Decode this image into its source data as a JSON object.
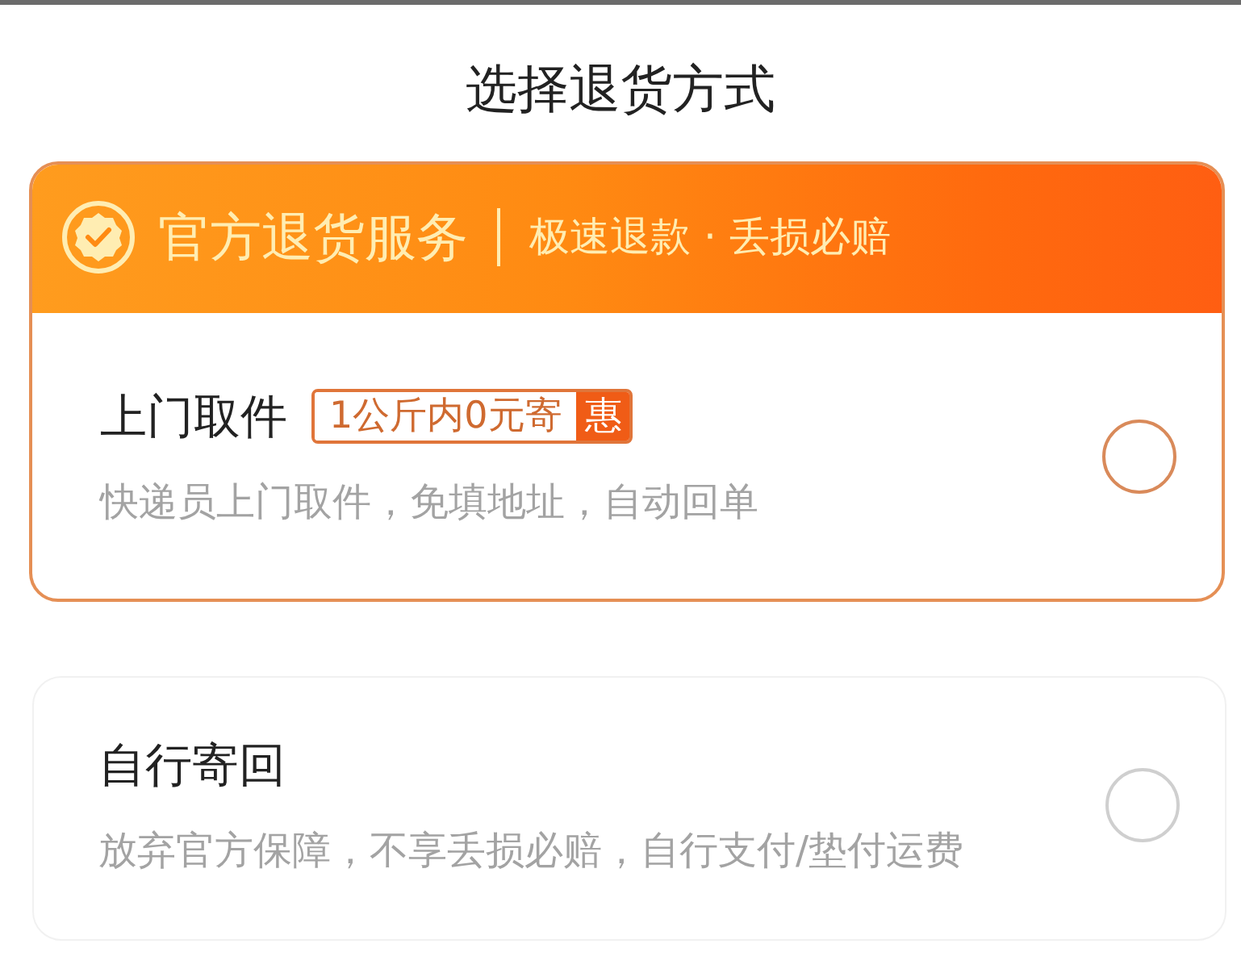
{
  "title": "选择退货方式",
  "options": [
    {
      "kind": "official",
      "banner": {
        "title": "官方退货服务",
        "tagline": "极速退款 · 丢损必赔"
      },
      "name": "上门取件",
      "tag": {
        "text": "1公斤内0元寄",
        "mark": "惠"
      },
      "description": "快递员上门取件，免填地址，自动回单",
      "selected": false
    },
    {
      "kind": "plain",
      "name": "自行寄回",
      "description": "放弃官方保障，不享丢损必赔，自行支付/垫付运费",
      "selected": false
    }
  ]
}
